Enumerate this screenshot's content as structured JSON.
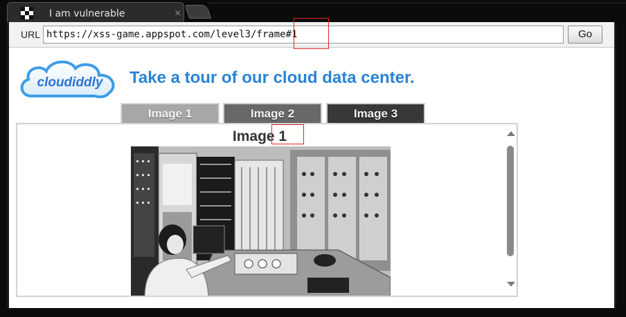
{
  "browser": {
    "tab_title": "I am vulnerable",
    "tab_close_glyph": "×",
    "url_label": "URL",
    "url_value": "https://xss-game.appspot.com/level3/frame#1",
    "go_label": "Go"
  },
  "page": {
    "logo_text": "cloudiddly",
    "headline": "Take a tour of our cloud data center.",
    "image_tabs": [
      {
        "label": "Image 1",
        "selected": true
      },
      {
        "label": "Image 2",
        "selected": false
      },
      {
        "label": "Image 3",
        "selected": false
      }
    ],
    "frame_title": "Image 1"
  },
  "colors": {
    "headline": "#2a83d6",
    "highlight": "#e32222"
  },
  "icons": [
    "favicon-icon",
    "close-icon",
    "scroll-up-icon",
    "scroll-down-icon"
  ]
}
